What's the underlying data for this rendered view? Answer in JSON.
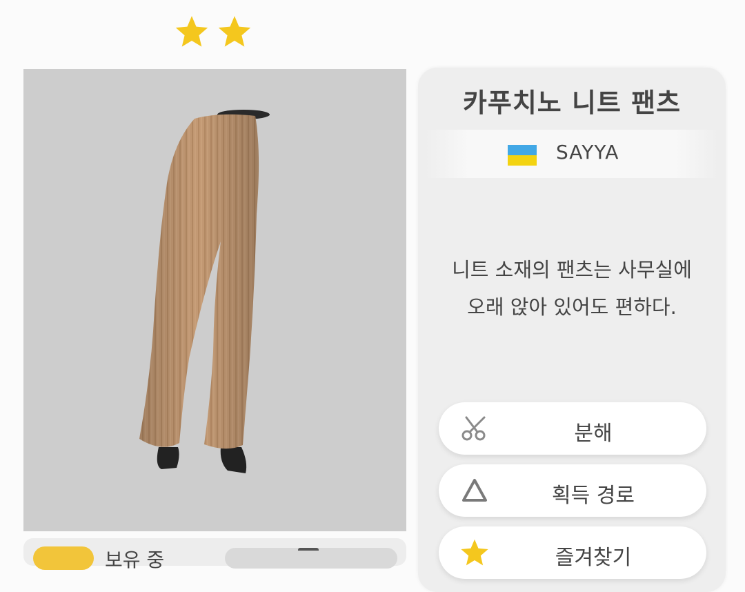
{
  "item": {
    "rarity_stars": 2,
    "name": "카푸치노 니트 팬츠",
    "brand": "SAYYA",
    "brand_flag_colors": [
      "#42a8e6",
      "#f3d311"
    ],
    "description_lines": [
      "니트 소재의 팬츠는 사무실에",
      "오래 앉아 있어도 편하다."
    ]
  },
  "actions": {
    "dismantle": {
      "label": "분해",
      "icon": "scissors-icon"
    },
    "acquire_route": {
      "label": "획득 경로",
      "icon": "triangle-icon"
    },
    "favorite": {
      "label": "즐겨찾기",
      "icon": "star-icon"
    }
  },
  "owned": {
    "label": "보유 중"
  },
  "colors": {
    "star": "#f4c71e",
    "preview_bg": "#cdcdcd",
    "garment": "#c49a74",
    "panel_bg": "#eeeeee"
  }
}
